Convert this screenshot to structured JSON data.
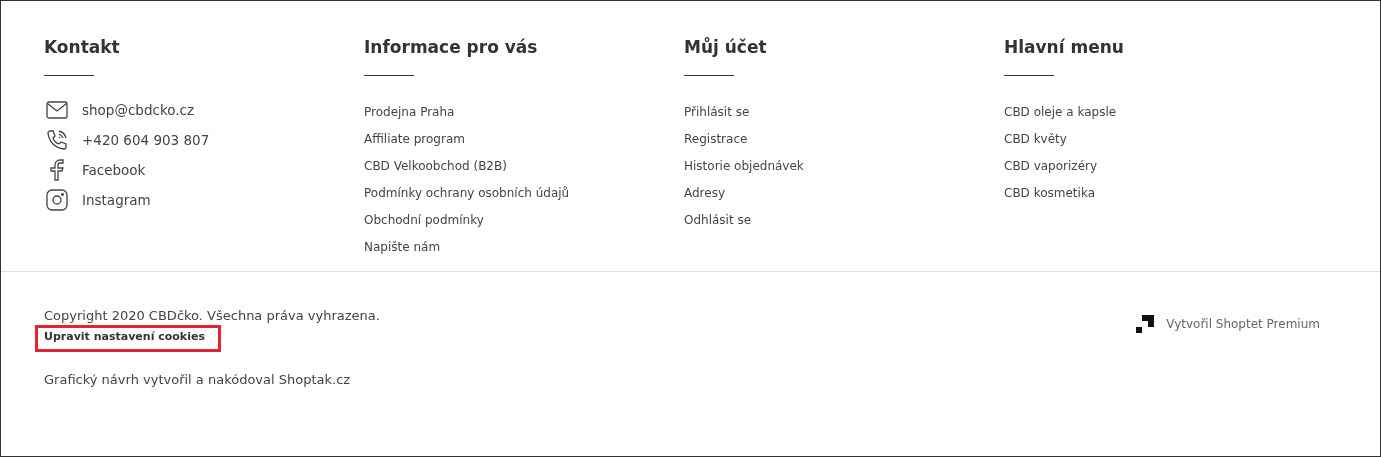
{
  "columns": [
    {
      "title": "Kontakt",
      "kind": "contact",
      "items": [
        {
          "label": "shop@cbdcko.cz",
          "kind": "mail"
        },
        {
          "label": "+420 604 903 807",
          "kind": "phone"
        },
        {
          "label": "Facebook",
          "kind": "facebook"
        },
        {
          "label": "Instagram",
          "kind": "instagram"
        }
      ]
    },
    {
      "title": "Informace pro vás",
      "kind": "links",
      "items": [
        {
          "label": "Prodejna Praha"
        },
        {
          "label": "Affiliate program"
        },
        {
          "label": "CBD Velkoobchod (B2B)"
        },
        {
          "label": "Podmínky ochrany osobních údajů"
        },
        {
          "label": "Obchodní podmínky"
        },
        {
          "label": "Napište nám"
        }
      ]
    },
    {
      "title": "Můj účet",
      "kind": "links",
      "items": [
        {
          "label": "Přihlásit se"
        },
        {
          "label": "Registrace"
        },
        {
          "label": "Historie objednávek"
        },
        {
          "label": "Adresy"
        },
        {
          "label": "Odhlásit se"
        }
      ]
    },
    {
      "title": "Hlavní menu",
      "kind": "links",
      "items": [
        {
          "label": "CBD oleje a kapsle"
        },
        {
          "label": "CBD květy"
        },
        {
          "label": "CBD vaporizéry"
        },
        {
          "label": "CBD kosmetika"
        }
      ]
    }
  ],
  "bottom": {
    "copyright": "Copyright 2020 CBDčko. Všechna práva vyhrazena.",
    "cookies_link": {
      "label": "Upravit nastavení cookies",
      "highlighted": true
    },
    "design_credit": "Grafický návrh vytvořil a nakódoval Shoptak.cz",
    "platform_credit": "Vytvořil Shoptet Premium"
  }
}
